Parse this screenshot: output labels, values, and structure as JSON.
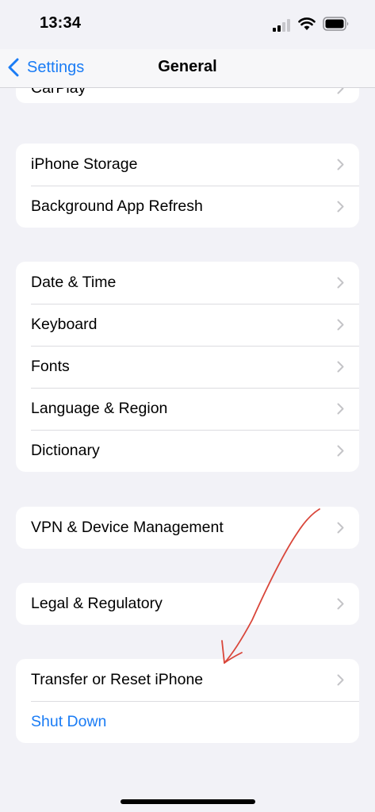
{
  "status_bar": {
    "time": "13:34"
  },
  "nav": {
    "back_label": "Settings",
    "title": "General"
  },
  "groups": {
    "carplay": [
      "CarPlay"
    ],
    "storage": [
      "iPhone Storage",
      "Background App Refresh"
    ],
    "locale": [
      "Date & Time",
      "Keyboard",
      "Fonts",
      "Language & Region",
      "Dictionary"
    ],
    "vpn": [
      "VPN & Device Management"
    ],
    "legal": [
      "Legal & Regulatory"
    ],
    "reset": [
      "Transfer or Reset iPhone",
      "Shut Down"
    ]
  },
  "colors": {
    "accent": "#1a7cf5",
    "background": "#f2f2f7",
    "annotation": "#d9463a"
  }
}
